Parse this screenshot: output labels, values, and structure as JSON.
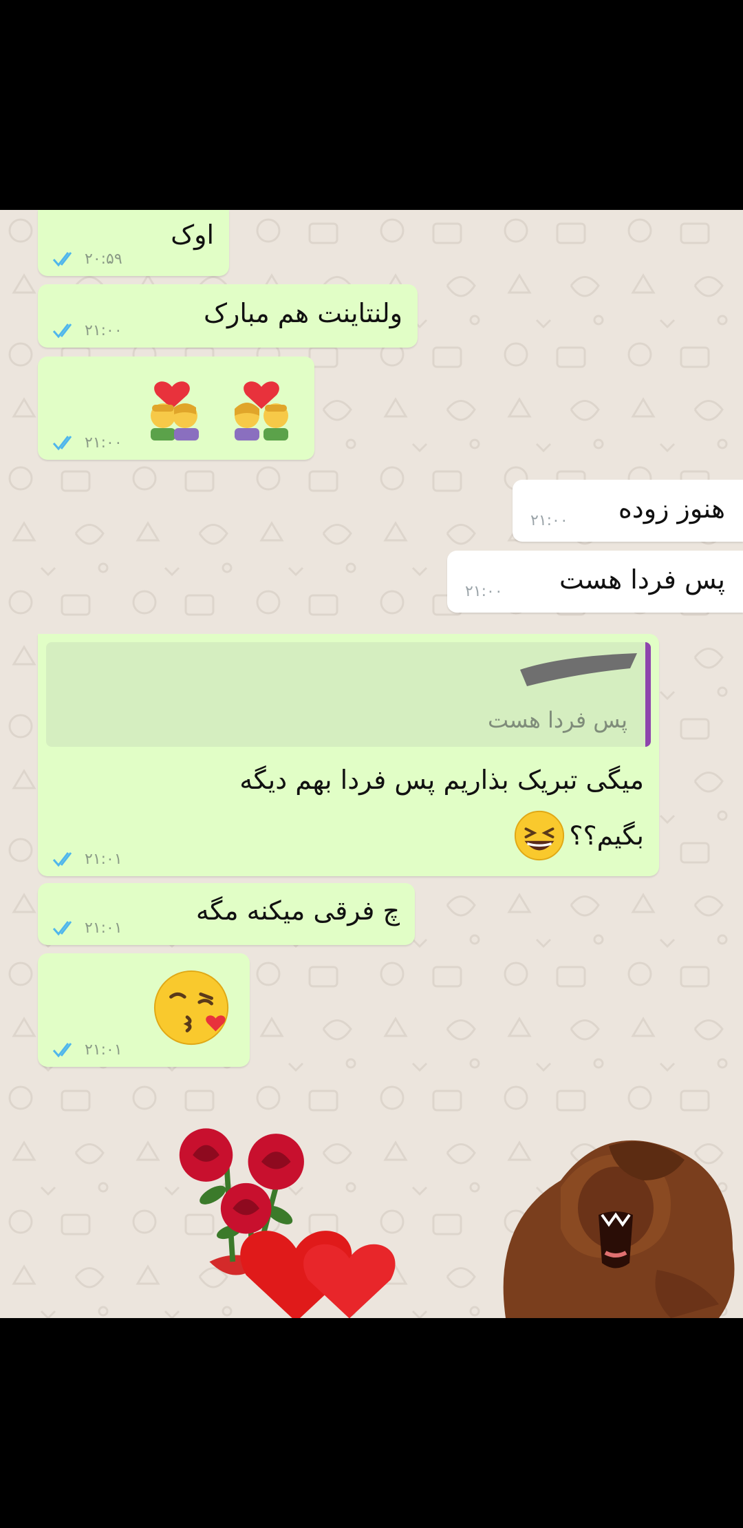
{
  "messages": [
    {
      "id": "m1",
      "dir": "out",
      "text": "اوک",
      "time": "۲۰:۵۹",
      "status": "read"
    },
    {
      "id": "m2",
      "dir": "out",
      "text": "ولنتاینت هم مبارک",
      "time": "۲۱:۰۰",
      "status": "read"
    },
    {
      "id": "m3",
      "dir": "out",
      "emoji": "couple-with-heart-emoji",
      "time": "۲۱:۰۰",
      "status": "read"
    },
    {
      "id": "m4",
      "dir": "in",
      "text": "هنوز زوده",
      "time": "۲۱:۰۰"
    },
    {
      "id": "m5",
      "dir": "in",
      "text": "پس فردا هست",
      "time": "۲۱:۰۰"
    },
    {
      "id": "m6",
      "dir": "out",
      "reply_to": "پس فردا هست",
      "line1": "میگی تبریک بذاریم پس فردا بهم دیگه",
      "line2": "بگیم؟؟",
      "emoji": "laughing-face-emoji",
      "time": "۲۱:۰۱",
      "status": "read"
    },
    {
      "id": "m7",
      "dir": "out",
      "text": "چ فرقی میکنه مگه",
      "time": "۲۱:۰۱",
      "status": "read"
    },
    {
      "id": "m8",
      "dir": "out",
      "emoji": "face-blowing-kiss-emoji",
      "time": "۲۱:۰۱",
      "status": "read"
    }
  ],
  "stickers": {
    "roses": "roses-hearts-sticker",
    "monkey": "laughing-orangutan-sticker"
  },
  "colors": {
    "outgoing_bubble": "#e1fec6",
    "incoming_bubble": "#ffffff",
    "chat_background": "#ece5dd",
    "read_ticks": "#4fb6ec",
    "reply_bar": "#8e44ad"
  }
}
